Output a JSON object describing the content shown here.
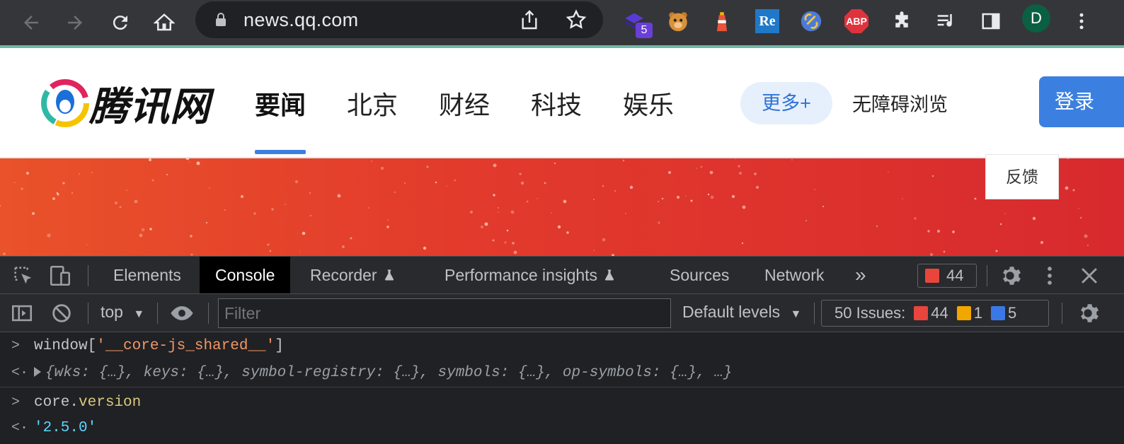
{
  "browser": {
    "url": "news.qq.com",
    "extension_badge": "5",
    "profile_initial": "D",
    "abp_label": "ABP",
    "re_label": "Re"
  },
  "site": {
    "logo_text": "腾讯网",
    "nav": [
      "要闻",
      "北京",
      "财经",
      "科技",
      "娱乐"
    ],
    "active_nav": "要闻",
    "more_label": "更多+",
    "accessibility_label": "无障碍浏览",
    "login_label": "登录",
    "feedback_label": "反馈",
    "accent_color": "#3b80e0"
  },
  "devtools": {
    "tabs": [
      "Elements",
      "Console",
      "Recorder",
      "Performance insights",
      "Sources",
      "Network"
    ],
    "active_tab": "Console",
    "more_tabs": "»",
    "error_count": "44",
    "context": "top",
    "filter_placeholder": "Filter",
    "levels": "Default levels",
    "issues_label": "50 Issues:",
    "issues_errors": "44",
    "issues_warnings": "1",
    "issues_info": "5"
  },
  "console": [
    {
      "type": "input",
      "parts": [
        "window[",
        "'__core-js_shared__'",
        "]"
      ]
    },
    {
      "type": "output",
      "text": "{wks: {…}, keys: {…}, symbol-registry: {…}, symbols: {…}, op-symbols: {…}, …}"
    },
    {
      "type": "input",
      "parts": [
        "core.",
        "version"
      ]
    },
    {
      "type": "output",
      "text": "'2.5.0'"
    }
  ]
}
